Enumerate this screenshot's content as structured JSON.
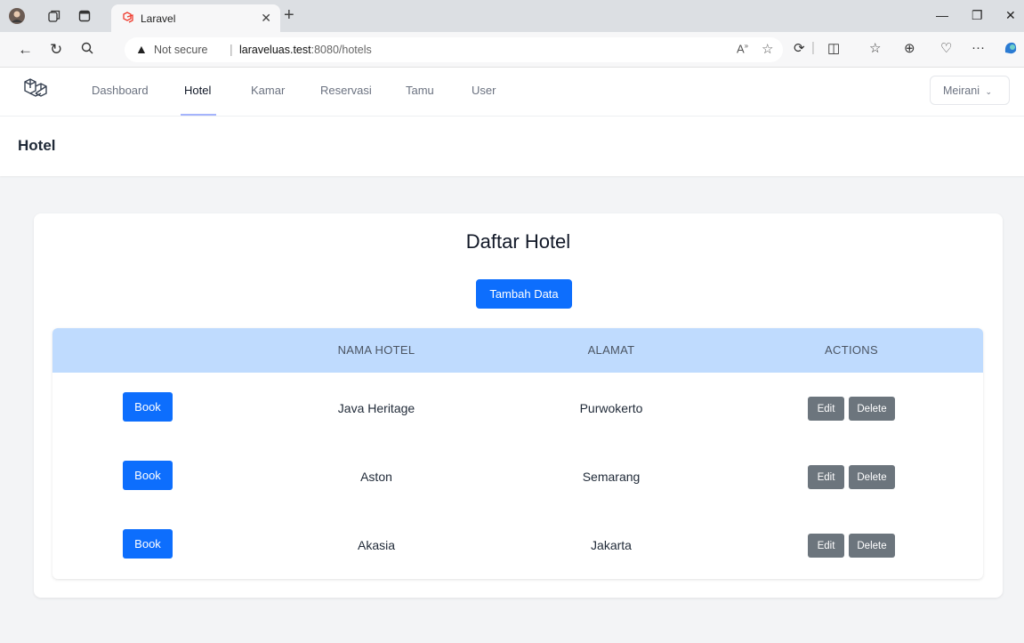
{
  "browser": {
    "tab_title": "Laravel",
    "address": {
      "warning": "Not secure",
      "host": "laraveluas.test",
      "path": ":8080/hotels"
    }
  },
  "nav": {
    "links": [
      "Dashboard",
      "Hotel",
      "Kamar",
      "Reservasi",
      "Tamu",
      "User"
    ],
    "active": "Hotel",
    "user_name": "Meirani"
  },
  "header": {
    "title": "Hotel"
  },
  "main": {
    "title": "Daftar Hotel",
    "add_label": "Tambah Data",
    "table": {
      "columns": [
        "",
        "NAMA HOTEL",
        "ALAMAT",
        "ACTIONS"
      ],
      "rows": [
        {
          "book": "Book",
          "nama": "Java Heritage",
          "alamat": "Purwokerto",
          "edit": "Edit",
          "delete": "Delete"
        },
        {
          "book": "Book",
          "nama": "Aston",
          "alamat": "Semarang",
          "edit": "Edit",
          "delete": "Delete"
        },
        {
          "book": "Book",
          "nama": "Akasia",
          "alamat": "Jakarta",
          "edit": "Edit",
          "delete": "Delete"
        }
      ]
    }
  },
  "colors": {
    "primary": "#0d6efd",
    "secondary": "#6c757d",
    "table_head": "#bfdbfe",
    "nav_underline": "#a5b4fc"
  }
}
